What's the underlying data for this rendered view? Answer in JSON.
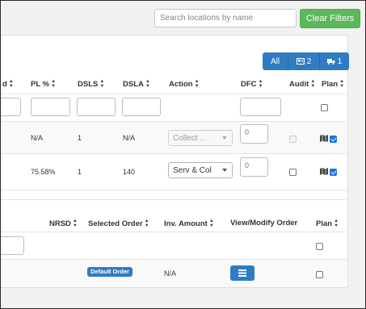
{
  "search": {
    "placeholder": "Search locations by name",
    "value": ""
  },
  "toolbar": {
    "clear_filters_label": "Clear Filters"
  },
  "view_toggle": {
    "all_label": "All",
    "count_a": "2",
    "count_b": "1"
  },
  "locations_table": {
    "headers": {
      "partial": "d",
      "pl_pct": "PL %",
      "dsls": "DSLS",
      "dsla": "DSLA",
      "action": "Action",
      "dfc": "DFC",
      "audit": "Audit",
      "plan": "Plan"
    },
    "rows": [
      {
        "pl_pct": "N/A",
        "dsls": "1",
        "dsla": "N/A",
        "action": "Collect ...",
        "dfc": "0",
        "audit_checked": false,
        "plan_checked": true
      },
      {
        "pl_pct": "75.58%",
        "dsls": "1",
        "dsla": "140",
        "action": "Serv & Col",
        "dfc": "0",
        "audit_checked": false,
        "plan_checked": true
      }
    ]
  },
  "orders_table": {
    "headers": {
      "nrsd": "NRSD",
      "selected_order": "Selected Order",
      "inv_amount": "Inv. Amount",
      "view_modify": "View/Modify Order",
      "plan": "Plan"
    },
    "rows": [
      {
        "selected_order": "Default Order",
        "inv_amount": "N/A",
        "plan_checked": false
      }
    ]
  },
  "colors": {
    "primary": "#2f7cc3",
    "success": "#5cb85c",
    "checkbox_checked": "#1a73e8"
  }
}
